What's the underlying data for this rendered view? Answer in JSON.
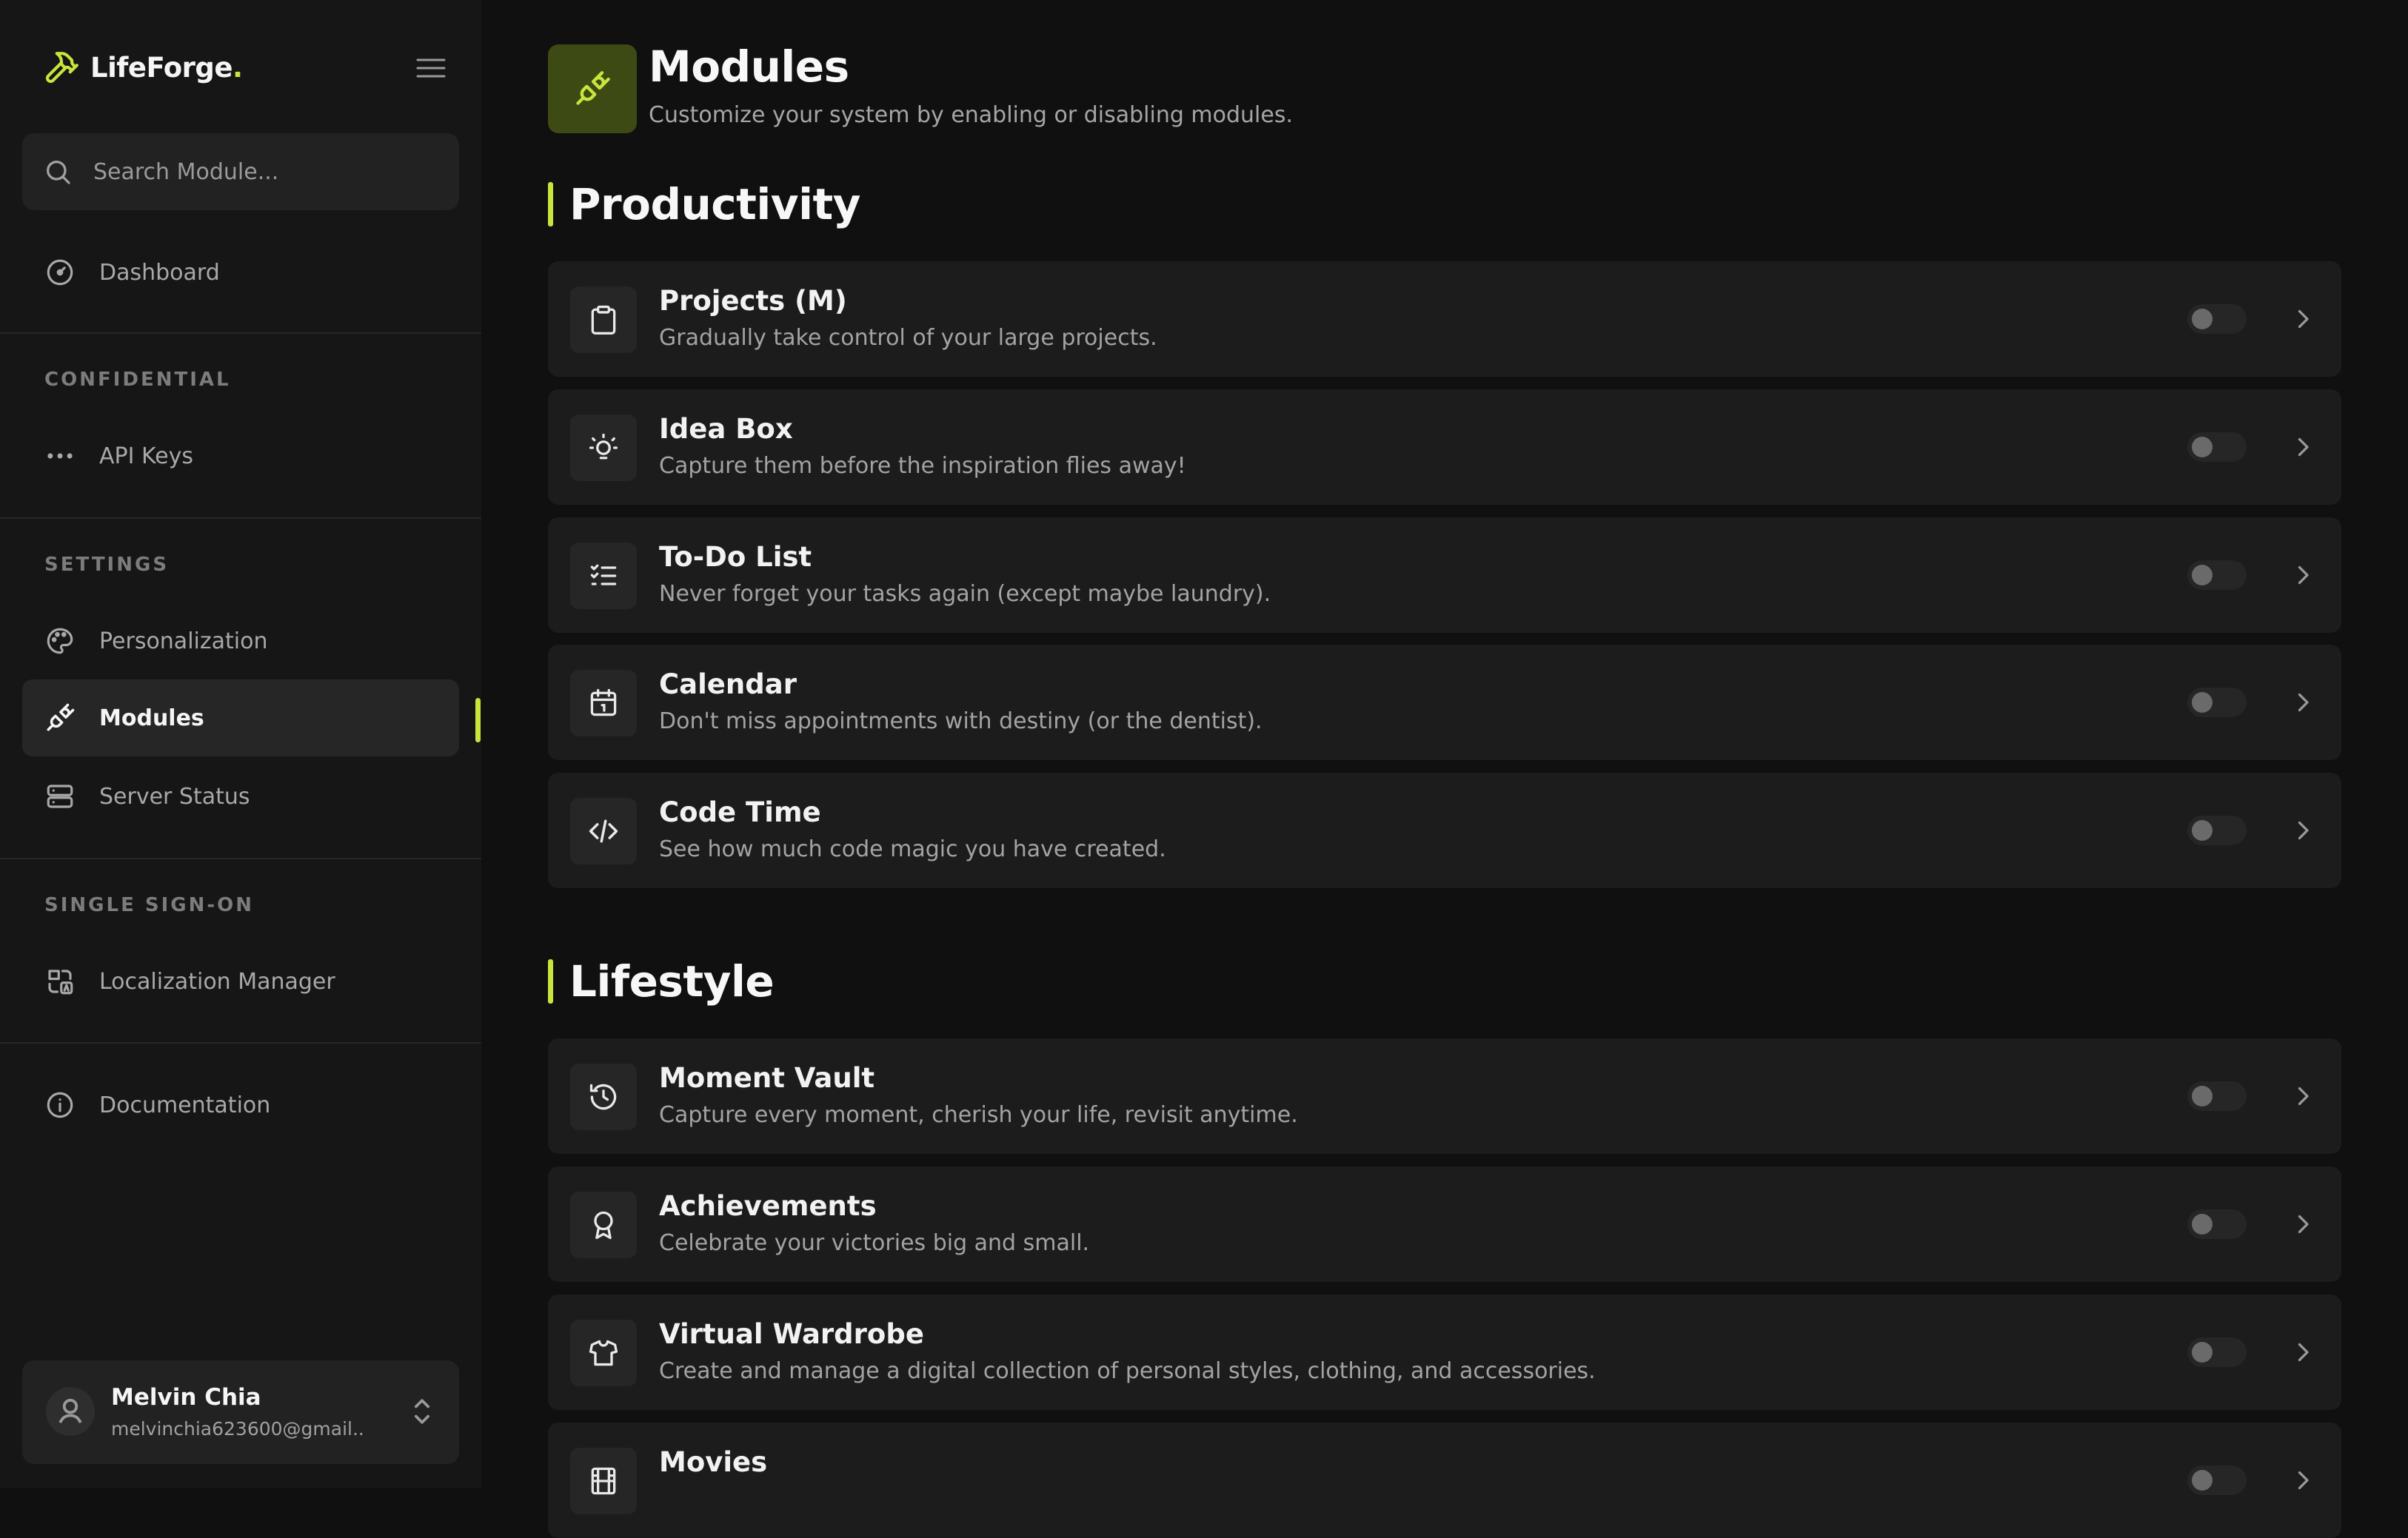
{
  "brand": {
    "name": "LifeForge",
    "dot": "."
  },
  "search": {
    "placeholder": "Search Module..."
  },
  "sidebar": {
    "dashboard": "Dashboard",
    "sections": {
      "confidential": "CONFIDENTIAL",
      "settings": "SETTINGS",
      "sso": "SINGLE SIGN-ON"
    },
    "items": {
      "api_keys": "API Keys",
      "personalization": "Personalization",
      "modules": "Modules",
      "server_status": "Server Status",
      "localization_manager": "Localization Manager",
      "documentation": "Documentation"
    },
    "active": "modules"
  },
  "user": {
    "name": "Melvin Chia",
    "email": "melvinchia623600@gmail...."
  },
  "header": {
    "title": "Modules",
    "subtitle": "Customize your system by enabling or disabling modules."
  },
  "categories": [
    {
      "title": "Productivity",
      "modules": [
        {
          "name": "Projects (M)",
          "description": "Gradually take control of your large projects.",
          "icon": "clipboard-icon",
          "enabled": false
        },
        {
          "name": "Idea Box",
          "description": "Capture them before the inspiration flies away!",
          "icon": "lightbulb-icon",
          "enabled": false
        },
        {
          "name": "To-Do List",
          "description": "Never forget your tasks again (except maybe laundry).",
          "icon": "checklist-icon",
          "enabled": false
        },
        {
          "name": "Calendar",
          "description": "Don't miss appointments with destiny (or the dentist).",
          "icon": "calendar-icon",
          "enabled": false
        },
        {
          "name": "Code Time",
          "description": "See how much code magic you have created.",
          "icon": "code-icon",
          "enabled": false
        }
      ]
    },
    {
      "title": "Lifestyle",
      "modules": [
        {
          "name": "Moment Vault",
          "description": "Capture every moment, cherish your life, revisit anytime.",
          "icon": "history-icon",
          "enabled": false
        },
        {
          "name": "Achievements",
          "description": "Celebrate your victories big and small.",
          "icon": "award-icon",
          "enabled": false
        },
        {
          "name": "Virtual Wardrobe",
          "description": "Create and manage a digital collection of personal styles, clothing, and accessories.",
          "icon": "shirt-icon",
          "enabled": false
        },
        {
          "name": "Movies",
          "description": "",
          "icon": "film-icon",
          "enabled": false
        }
      ]
    }
  ],
  "colors": {
    "accent": "#c9e43b",
    "background": "#101010",
    "sidebar": "#161616",
    "card": "#1c1c1c"
  }
}
